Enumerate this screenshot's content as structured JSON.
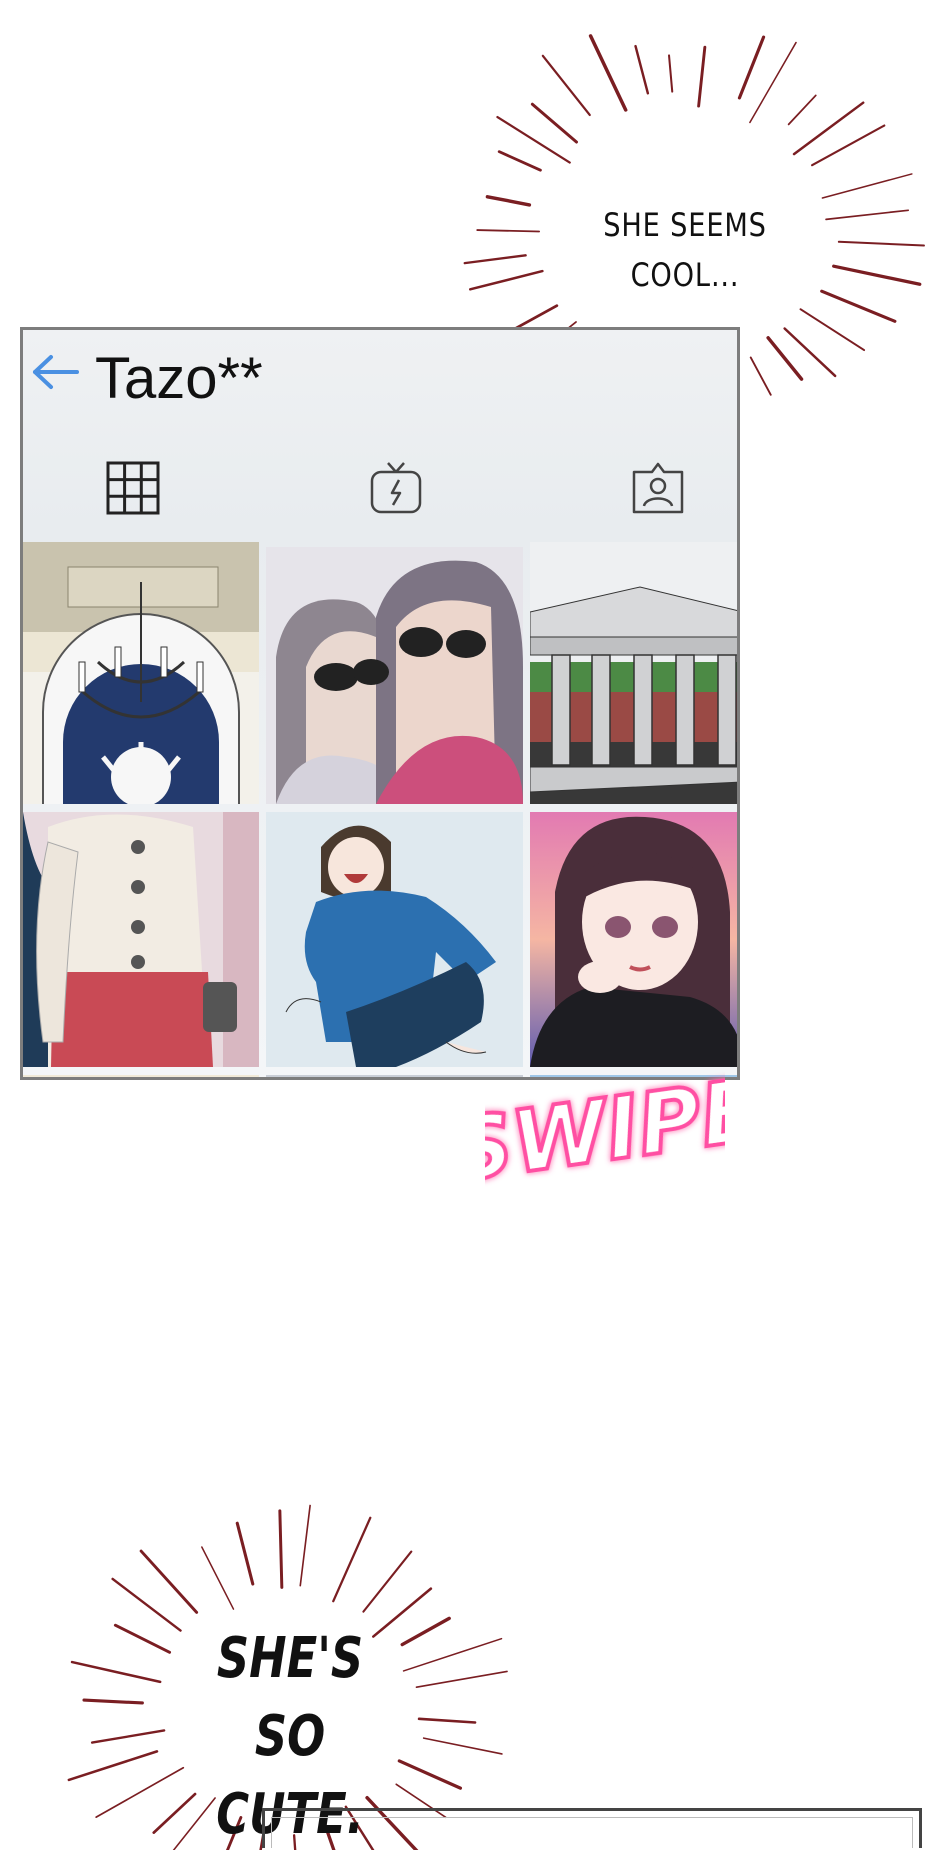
{
  "bubbles": {
    "top_line1": "SHE SEEMS",
    "top_line2": "COOL...",
    "bottom_line1": "SHE'S",
    "bottom_line2": "SO CUTE."
  },
  "profile": {
    "username": "Tazo**",
    "back_icon": "arrow-left-icon",
    "tabs": [
      {
        "icon": "grid-icon",
        "active": true
      },
      {
        "icon": "tv-icon",
        "active": false
      },
      {
        "icon": "tagged-person-icon",
        "active": false
      }
    ],
    "posts": [
      {
        "subject": "chandelier"
      },
      {
        "subject": "two women in sunglasses"
      },
      {
        "subject": "building with columns"
      },
      {
        "subject": "cardigan and red skirt"
      },
      {
        "subject": "laughing girl in blue shirt"
      },
      {
        "subject": "girl with dark hair portrait"
      }
    ]
  },
  "sfx": "SWIPE",
  "colors": {
    "burst": "#7a1e22",
    "back_arrow": "#4a90e2",
    "swipe_glow": "#ff4fa3",
    "frame": "#7d7d7d"
  }
}
